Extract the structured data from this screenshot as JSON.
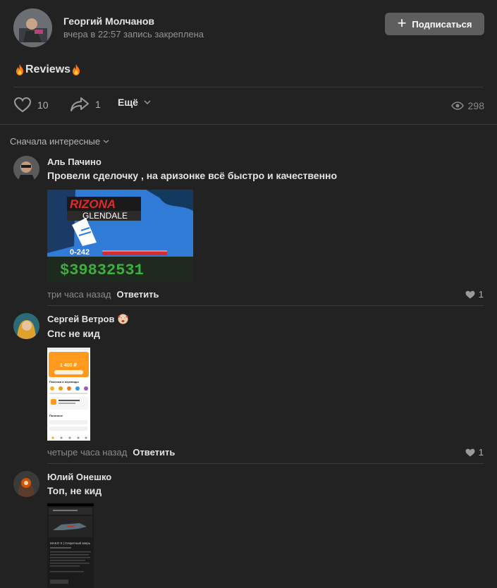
{
  "post": {
    "author": "Георгий Молчанов",
    "meta": "вчера в 22:57 запись закреплена",
    "subscribe_label": "Подписаться",
    "text": "Reviews",
    "likes": "10",
    "shares": "1",
    "more_label": "Ещё",
    "views": "298"
  },
  "sort_label": "Сначала интересные",
  "comments": [
    {
      "name": "Аль Пачино",
      "text": "Провели сделочку , на аризонке всё быстро и качественно",
      "time": "три часа назад",
      "reply": "Ответить",
      "likes": "1",
      "image": {
        "brand": "RIZONA",
        "server": "GLENDALE",
        "id": "0-242",
        "money": "$39832531"
      }
    },
    {
      "name": "Сергей Ветров",
      "text": "Спс не кид",
      "time": "четыре часа назад",
      "reply": "Ответить",
      "likes": "1",
      "image": {
        "amount": "1 400 ₽",
        "section1": "Платежи и переводы",
        "section2": "Полезное"
      }
    },
    {
      "name": "Юлий Онешко",
      "text": "Топ, не кид",
      "image": {
        "title": "MAKO S | Секретный зверь"
      }
    }
  ],
  "colors": {
    "background": "#222222",
    "accent_orange": "#ff9a1f",
    "arizona_blue": "#2f7bd6"
  }
}
